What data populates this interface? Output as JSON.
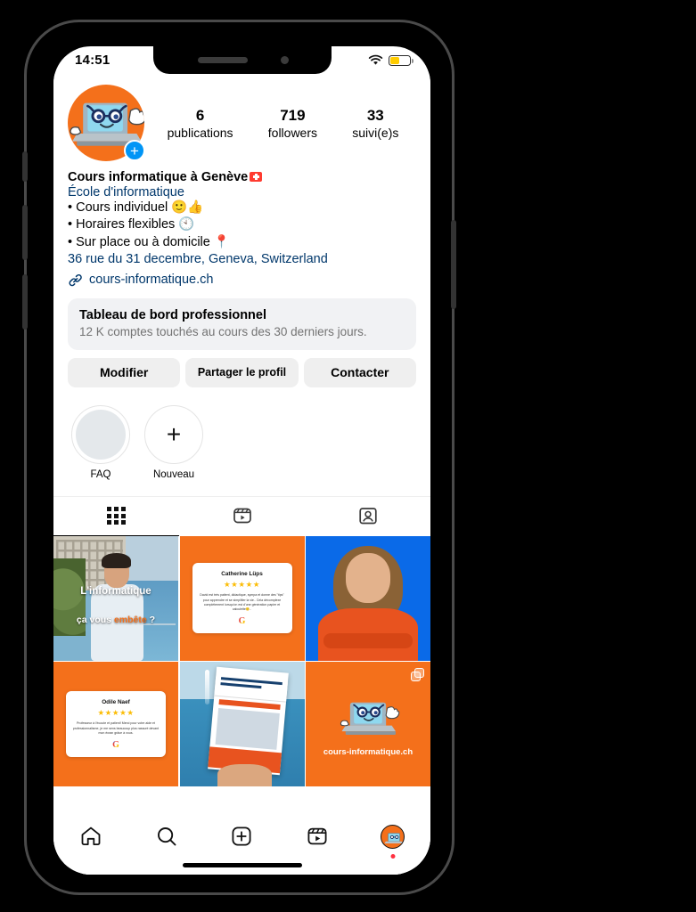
{
  "status_bar": {
    "time": "14:51",
    "wifi_icon": "wifi-icon",
    "battery_icon": "battery-low-power-icon"
  },
  "profile": {
    "avatar_alt": "laptop-mascot-avatar",
    "add_story_label": "+",
    "stats": [
      {
        "number": "6",
        "label": "publications"
      },
      {
        "number": "719",
        "label": "followers"
      },
      {
        "number": "33",
        "label": "suivi(e)s"
      }
    ],
    "display_name": "Cours informatique à Genève",
    "name_flag": "swiss-flag",
    "category": "École d'informatique",
    "bio_lines": [
      "• Cours individuel 🙂👍",
      "• Horaires flexibles 🕙",
      "• Sur place ou à domicile 📍"
    ],
    "address": "36 rue du 31 decembre, Geneva, Switzerland",
    "website": "cours-informatique.ch"
  },
  "dashboard": {
    "title": "Tableau de bord professionnel",
    "subtitle": "12 K comptes touchés au cours des 30 derniers jours."
  },
  "actions": {
    "edit": "Modifier",
    "share": "Partager le profil",
    "contact": "Contacter"
  },
  "highlights": [
    {
      "label": "FAQ",
      "type": "cover"
    },
    {
      "label": "Nouveau",
      "type": "new"
    }
  ],
  "tabs": [
    {
      "name": "grid",
      "icon": "grid-icon",
      "active": true
    },
    {
      "name": "reels",
      "icon": "reels-icon",
      "active": false
    },
    {
      "name": "tagged",
      "icon": "tagged-icon",
      "active": false
    }
  ],
  "posts": [
    {
      "id": 1,
      "kind": "photo",
      "caption_line1": "L'informatique",
      "caption_line2_a": "ça vous ",
      "caption_line2_b": "embête",
      "caption_line2_c": " ?",
      "carousel": false
    },
    {
      "id": 2,
      "kind": "review",
      "reviewer": "Catherine Lüps",
      "stars": "★★★★★",
      "text": "David est très patient, didactique, sympa et donne des \"tips\" pour apprendre et se simplifier la vie.. Cela décomplexe complètement lorsqu'on est d'une génération papier et calculette🙂..",
      "source_icon": "google-g-icon",
      "carousel": false
    },
    {
      "id": 3,
      "kind": "portrait",
      "carousel": false
    },
    {
      "id": 4,
      "kind": "review",
      "reviewer": "Odile Naef",
      "stars": "★★★★★",
      "text": "Professeur à l'écoute et patient! Merci pour votre aide et professionnalisme, je me sens beaucoup plus rassuré devant mon écran grâce à vous.",
      "source_icon": "google-g-icon",
      "carousel": false
    },
    {
      "id": 5,
      "kind": "flyer",
      "carousel": false
    },
    {
      "id": 6,
      "kind": "logo",
      "caption": "cours-informatique.ch",
      "carousel": true
    }
  ],
  "bottom_nav": [
    {
      "name": "home",
      "icon": "home-icon",
      "active": false
    },
    {
      "name": "search",
      "icon": "search-icon",
      "active": false
    },
    {
      "name": "create",
      "icon": "plus-square-icon",
      "active": false
    },
    {
      "name": "reels",
      "icon": "reels-icon",
      "active": false
    },
    {
      "name": "profile",
      "icon": "profile-avatar-icon",
      "active": true
    }
  ],
  "colors": {
    "brand_orange": "#F4701B",
    "link_blue": "#00376B",
    "accent_blue": "#0095F6",
    "star_gold": "#FBBC05",
    "badge_red": "#FF3040"
  }
}
